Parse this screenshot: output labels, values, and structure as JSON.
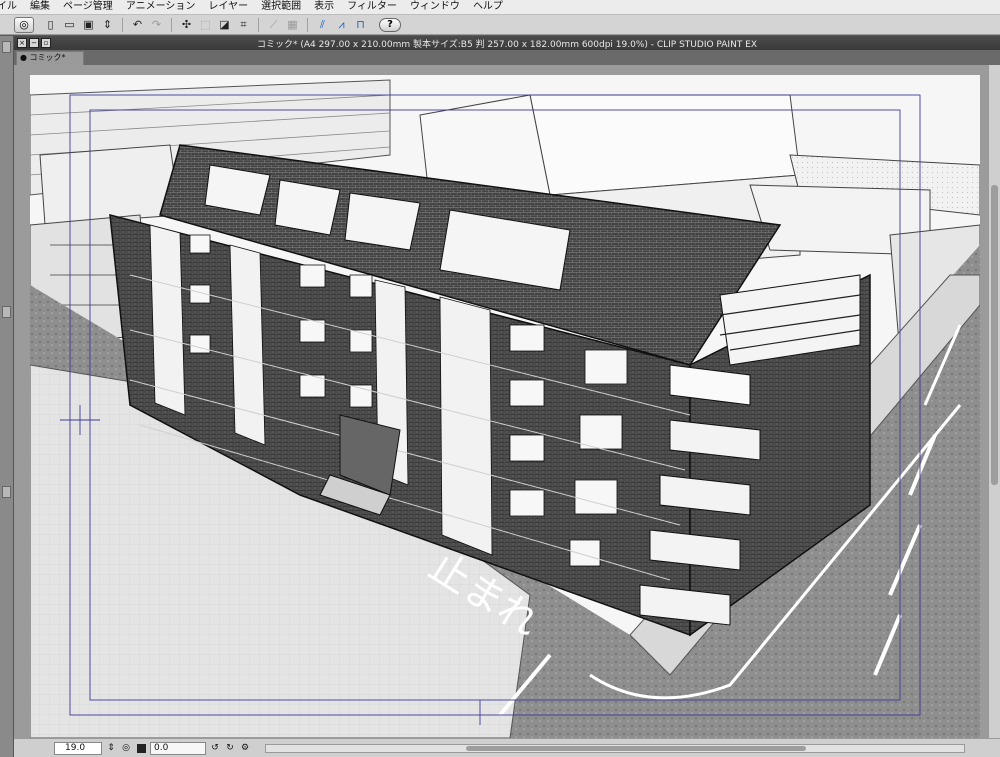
{
  "menu": {
    "items": [
      "イル",
      "編集",
      "ページ管理",
      "アニメーション",
      "レイヤー",
      "選択範囲",
      "表示",
      "フィルター",
      "ウィンドウ",
      "ヘルプ"
    ]
  },
  "toolbar": {
    "icons": [
      "clip-studio-logo-icon",
      "new-file-icon",
      "open-file-icon",
      "save-icon",
      "undo-icon",
      "redo-icon",
      "transform-icon",
      "select-all-icon",
      "fill-icon",
      "crop-icon",
      "ruler-icon",
      "snap-icon",
      "perspective-icon",
      "help-icon"
    ],
    "help_label": "?"
  },
  "window": {
    "title": "コミック* (A4 297.00 x 210.00mm 製本サイズ:B5 判 257.00 x 182.00mm 600dpi 19.0%)  - CLIP STUDIO PAINT EX",
    "buttons": [
      "close-icon",
      "minimize-icon",
      "zoom-icon"
    ]
  },
  "document_tab": {
    "label": "コミック*"
  },
  "artwork": {
    "road_marking": "止まれ",
    "accent_guide_color": "#3b3b9a",
    "description_colors": {
      "building": "#2e2e2e",
      "road": "#8c8c8c",
      "roof": "#3a3a3a"
    }
  },
  "statusbar": {
    "zoom_value": "19.0",
    "rotation_value": "0.0"
  }
}
